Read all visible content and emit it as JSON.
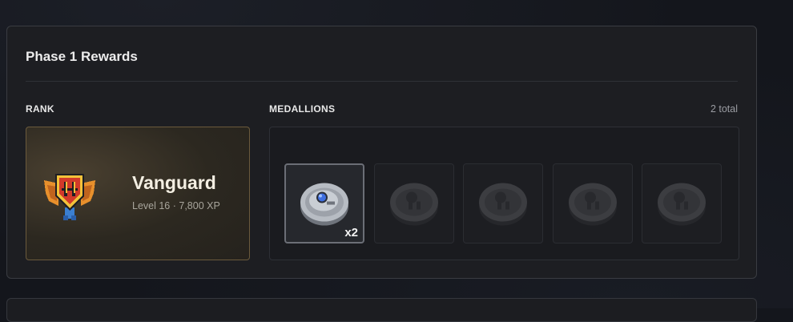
{
  "panel": {
    "title": "Phase 1 Rewards"
  },
  "rank": {
    "section_label": "RANK",
    "name": "Vanguard",
    "subtitle": "Level 16 · 7,800 XP",
    "emblem_icon": "vanguard-rank-emblem-icon"
  },
  "medallions": {
    "section_label": "MEDALLIONS",
    "total_label": "2 total",
    "slots": [
      {
        "state": "earned",
        "count_label": "x2",
        "icon": "silver-medallion-icon"
      },
      {
        "state": "locked",
        "icon": "locked-medallion-icon"
      },
      {
        "state": "locked",
        "icon": "locked-medallion-icon"
      },
      {
        "state": "locked",
        "icon": "locked-medallion-icon"
      },
      {
        "state": "locked",
        "icon": "locked-medallion-icon"
      }
    ]
  },
  "colors": {
    "panel_bg": "#1d1e22",
    "rank_border": "#6b5a3c",
    "gem_blue": "#3f6fe0"
  }
}
